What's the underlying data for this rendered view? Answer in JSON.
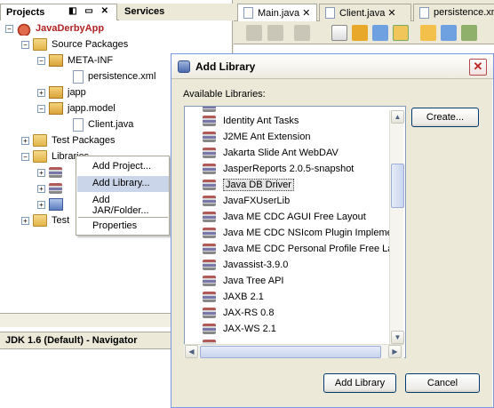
{
  "left_tabs": {
    "projects": "Projects",
    "services": "Services"
  },
  "tree": {
    "project": "JavaDerbyApp",
    "source_packages": "Source Packages",
    "meta_inf": "META-INF",
    "persistence_xml": "persistence.xml",
    "japp": "japp",
    "japp_model": "japp.model",
    "client_java": "Client.java",
    "test_packages": "Test Packages",
    "libraries": "Libraries",
    "test_libs_partial": "Test"
  },
  "navigator": "JDK 1.6 (Default) - Navigator",
  "editor_tabs": [
    "Main.java",
    "Client.java",
    "persistence.xm"
  ],
  "context_menu": {
    "items": [
      "Add Project...",
      "Add Library...",
      "Add JAR/Folder...",
      "Properties"
    ]
  },
  "dialog": {
    "title": "Add Library",
    "available_label": "Available Libraries:",
    "create_button": "Create...",
    "add_button": "Add Library",
    "cancel_button": "Cancel",
    "libraries": [
      "Identity Ant Tasks",
      "J2ME Ant Extension",
      "Jakarta Slide Ant WebDAV",
      "JasperReports 2.0.5-snapshot",
      "Java DB Driver",
      "JavaFXUserLib",
      "Java ME CDC AGUI Free Layout",
      "Java ME CDC NSIcom Plugin Implement",
      "Java ME CDC Personal Profile Free Lay",
      "Javassist-3.9.0",
      "Java Tree API",
      "JAXB 2.1",
      "JAX-RS 0.8",
      "JAX-WS 2.1"
    ],
    "selected": "Java DB Driver"
  },
  "colors": {
    "selection": "#CBD5EA",
    "project_name": "#B22222",
    "button_border": "#003C74"
  }
}
